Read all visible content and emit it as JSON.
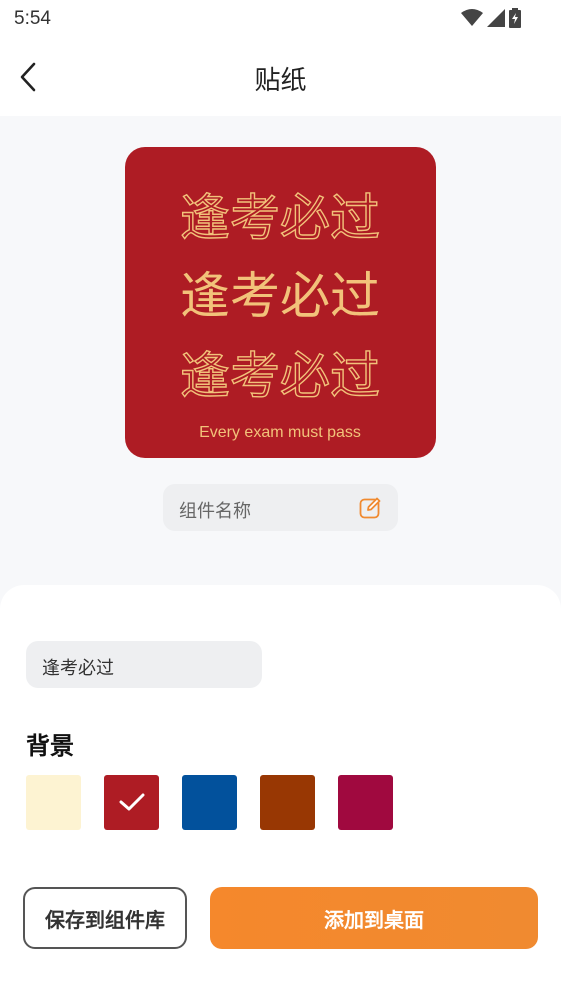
{
  "status_bar": {
    "time": "5:54",
    "icons": [
      "wifi-icon",
      "signal-icon",
      "battery-icon"
    ]
  },
  "nav": {
    "title": "贴纸",
    "back_icon": "chevron-left-icon"
  },
  "sticker": {
    "line1": "逢考必过",
    "line2": "逢考必过",
    "line3": "逢考必过",
    "subtitle": "Every exam must pass",
    "bg_color": "#ae1c24",
    "text_color": "#f2c27a"
  },
  "name_field": {
    "placeholder": "组件名称",
    "edit_icon": "edit-icon"
  },
  "text_field": {
    "value": "逢考必过"
  },
  "background": {
    "heading": "背景",
    "swatches": [
      {
        "color": "#fdf3d2",
        "selected": false
      },
      {
        "color": "#ae1c24",
        "selected": true
      },
      {
        "color": "#02519c",
        "selected": false
      },
      {
        "color": "#983703",
        "selected": false
      },
      {
        "color": "#a0093f",
        "selected": false
      }
    ]
  },
  "buttons": {
    "save_label": "保存到组件库",
    "add_label": "添加到桌面"
  },
  "colors": {
    "accent": "#f5882c",
    "panel_bg": "#ffffff",
    "page_bg": "#f7f8fa"
  }
}
